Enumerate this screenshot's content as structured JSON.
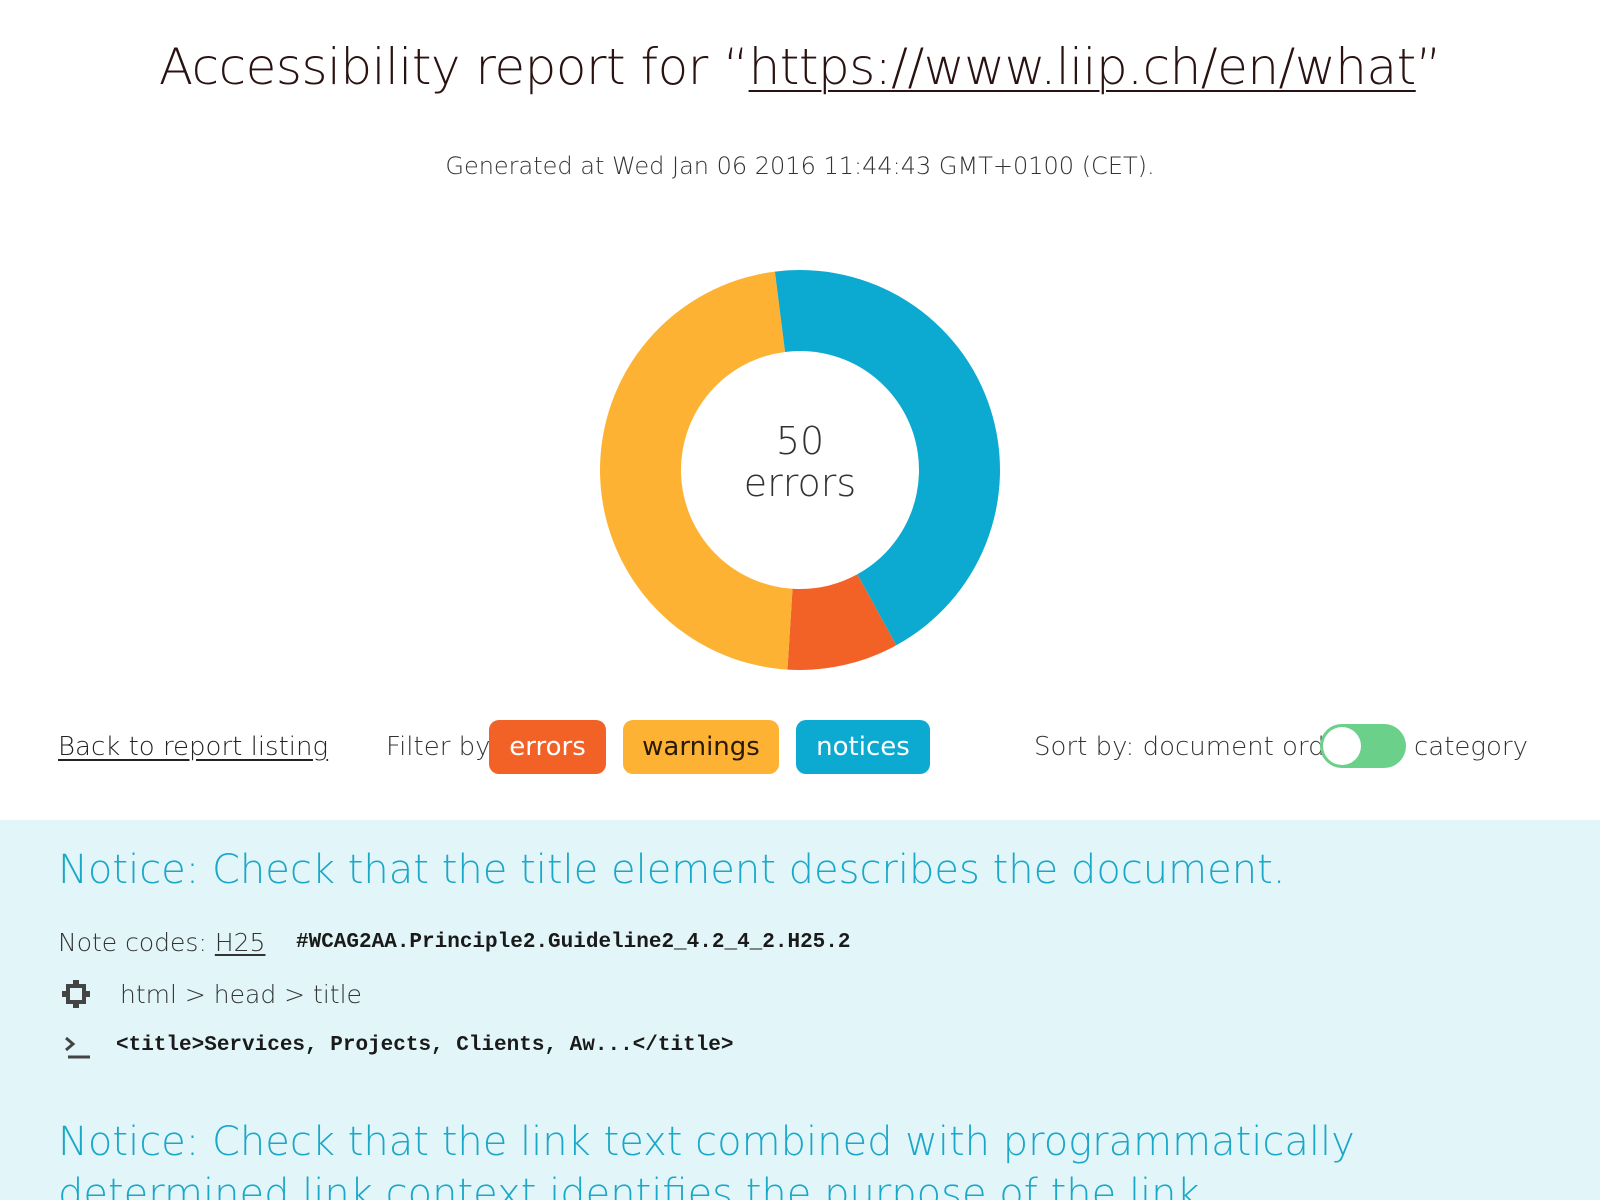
{
  "header": {
    "title_prefix": "Accessibility report for “",
    "url": "https://www.liip.ch/en/what",
    "title_suffix": "”",
    "generated": "Generated at Wed Jan 06 2016 11:44:43 GMT+0100 (CET)."
  },
  "chart_data": {
    "type": "pie",
    "center_value": "50",
    "center_label": "errors",
    "slices": [
      {
        "category": "errors",
        "fraction": 0.09,
        "color": "#f26227"
      },
      {
        "category": "warnings",
        "fraction": 0.47,
        "color": "#fdb234"
      },
      {
        "category": "notices",
        "fraction": 0.44,
        "color": "#0caad1"
      }
    ]
  },
  "controls": {
    "back_link": "Back to report listing",
    "filter_label": "Filter by:",
    "filters": {
      "errors": "errors",
      "warnings": "warnings",
      "notices": "notices"
    },
    "sort_label": "Sort by: document order",
    "sort_alt": "category",
    "toggle_on": true
  },
  "results": [
    {
      "title": "Notice: Check that the title element describes the document.",
      "codes_label": "Note codes:",
      "code_link": "H25",
      "code_full": "#WCAG2AA.Principle2.Guideline2_4.2_4_2.H25.2",
      "selector": "html > head > title",
      "context": "<title>Services, Projects, Clients, Aw...</title>"
    },
    {
      "title": "Notice: Check that the link text combined with programmatically determined link context identifies the purpose of the link."
    }
  ],
  "icons": {
    "selector": "chip-icon",
    "context": "terminal-icon"
  }
}
